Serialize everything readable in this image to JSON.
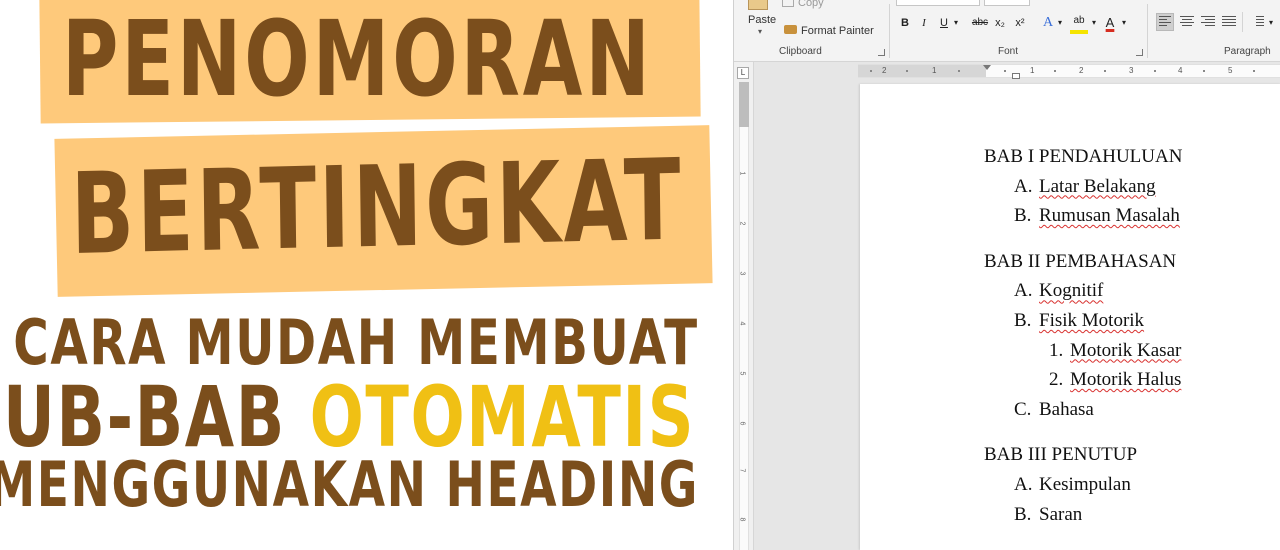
{
  "promo": {
    "title_line1": "PENOMORAN",
    "title_line2": "BERTINGKAT",
    "subtitle_line1": "CARA MUDAH MEMBUAT",
    "subtitle_line2_part1": "SUB-BAB",
    "subtitle_line2_highlight": "OTOMATIS",
    "subtitle_line3": "MENGGUNAKAN HEADING",
    "colors": {
      "title": "#7b4e1c",
      "band": "#fec97b",
      "highlight": "#f0c014"
    }
  },
  "ribbon": {
    "clipboard": {
      "copy_label": "Copy",
      "paste_label": "Paste",
      "format_painter_label": "Format Painter",
      "group_label": "Clipboard"
    },
    "font": {
      "bold": "B",
      "italic": "I",
      "underline": "U",
      "strikethrough": "abc",
      "subscript": "x₂",
      "superscript": "x²",
      "text_effects": "A",
      "highlight": "ab",
      "font_color": "A",
      "group_label": "Font"
    },
    "paragraph": {
      "group_label": "Paragraph"
    }
  },
  "ruler": {
    "tab_selector": "L",
    "horizontal_numbers": [
      "2",
      "1",
      "1",
      "2",
      "3",
      "4",
      "5"
    ],
    "vertical_numbers": [
      "1",
      "2",
      "3",
      "4",
      "5",
      "6",
      "7",
      "8"
    ]
  },
  "document": {
    "items": [
      {
        "level": 0,
        "marker": "",
        "text": "BAB I PENDAHULUAN",
        "spell": false
      },
      {
        "level": 1,
        "marker": "A.",
        "text": "Latar Belakang",
        "spell": true
      },
      {
        "level": 1,
        "marker": "B.",
        "text": "Rumusan Masalah",
        "spell": true
      },
      {
        "level": 0,
        "marker": "",
        "text": "BAB II PEMBAHASAN",
        "spell": false
      },
      {
        "level": 1,
        "marker": "A.",
        "text": "Kognitif",
        "spell": true
      },
      {
        "level": 1,
        "marker": "B.",
        "text": "Fisik Motorik",
        "spell": true
      },
      {
        "level": 2,
        "marker": "1.",
        "text": "Motorik Kasar",
        "spell": true
      },
      {
        "level": 2,
        "marker": "2.",
        "text": "Motorik Halus",
        "spell": true
      },
      {
        "level": 1,
        "marker": "C.",
        "text": "Bahasa",
        "spell": false
      },
      {
        "level": 0,
        "marker": "",
        "text": "BAB III PENUTUP",
        "spell": false
      },
      {
        "level": 1,
        "marker": "A.",
        "text": "Kesimpulan",
        "spell": false
      },
      {
        "level": 1,
        "marker": "B.",
        "text": "Saran",
        "spell": false
      }
    ]
  }
}
